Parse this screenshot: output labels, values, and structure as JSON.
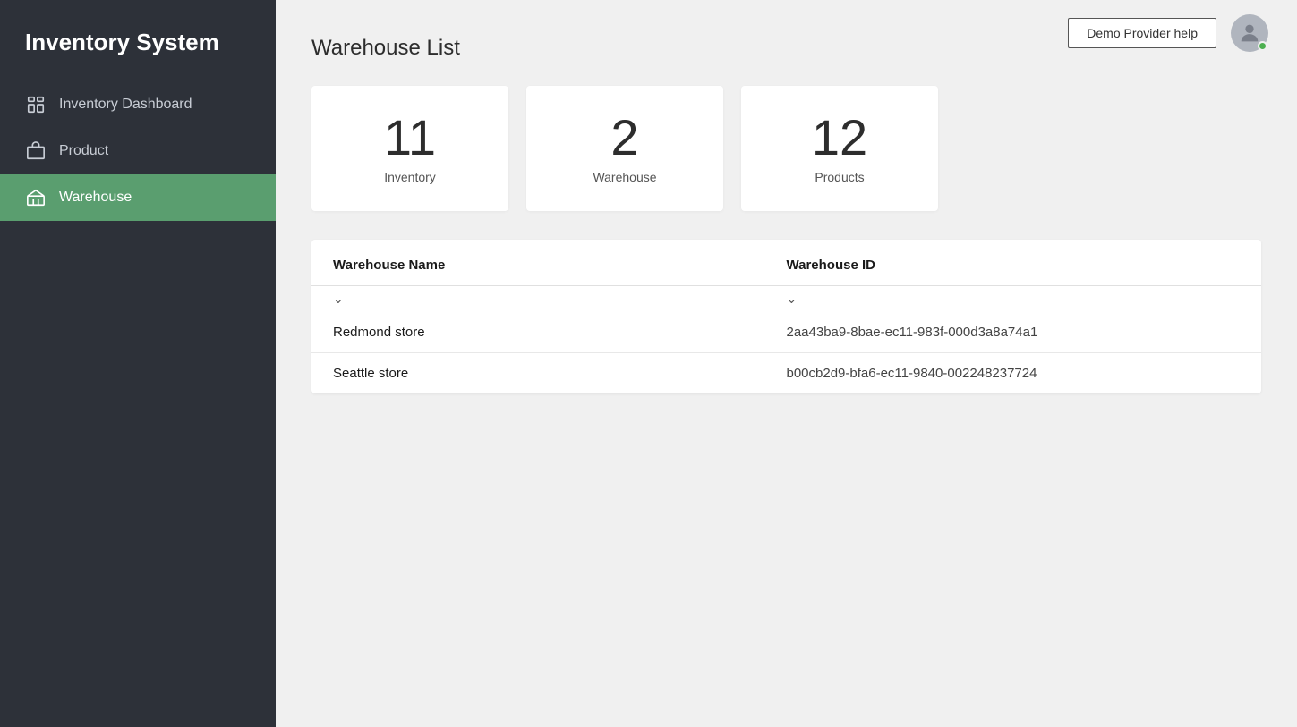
{
  "app": {
    "title": "Inventory System"
  },
  "sidebar": {
    "nav_items": [
      {
        "id": "dashboard",
        "label": "Inventory Dashboard",
        "icon": "dashboard-icon",
        "active": false
      },
      {
        "id": "product",
        "label": "Product",
        "icon": "product-icon",
        "active": false
      },
      {
        "id": "warehouse",
        "label": "Warehouse",
        "icon": "warehouse-icon",
        "active": true
      }
    ]
  },
  "header": {
    "page_title": "Warehouse List",
    "help_button_label": "Demo Provider help"
  },
  "stats": [
    {
      "id": "inventory",
      "number": "11",
      "label": "Inventory"
    },
    {
      "id": "warehouse",
      "number": "2",
      "label": "Warehouse"
    },
    {
      "id": "products",
      "number": "12",
      "label": "Products"
    }
  ],
  "table": {
    "columns": [
      {
        "id": "name",
        "label": "Warehouse Name"
      },
      {
        "id": "id",
        "label": "Warehouse ID"
      }
    ],
    "rows": [
      {
        "name": "Redmond store",
        "id": "2aa43ba9-8bae-ec11-983f-000d3a8a74a1"
      },
      {
        "name": "Seattle store",
        "id": "b00cb2d9-bfa6-ec11-9840-002248237724"
      }
    ]
  }
}
